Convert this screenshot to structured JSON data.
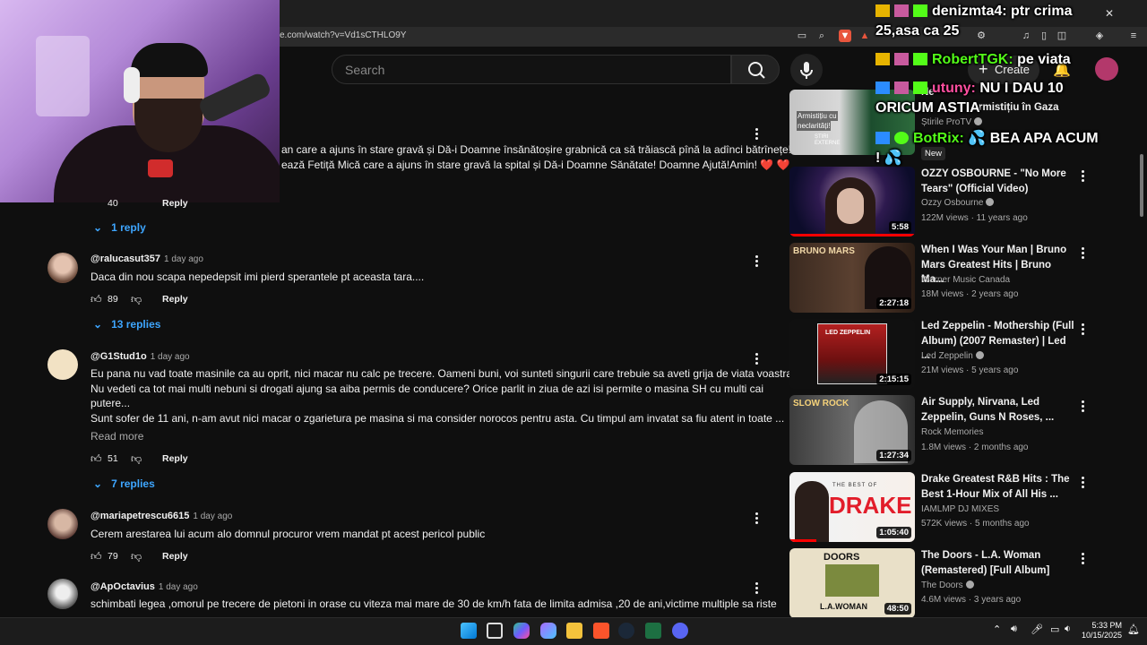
{
  "browser": {
    "url": "e.com/watch?v=Vd1sCTHLO9Y"
  },
  "header": {
    "search_placeholder": "Search",
    "create_label": "Create"
  },
  "comments": {
    "pinned_text_line1": "an care a ajuns în stare gravă și Dă-i Doamne însănătoșire grabnică ca să trăiască pînă la adînci bătrînețe!",
    "pinned_text_line2": "ează Fetiță Mică care a ajuns în stare gravă la spital și Dă-i Doamne Sănătate! Doamne Ajută!Amin! ❤️ ❤️",
    "pinned_likes": "40",
    "pinned_reply": "Reply",
    "pinned_replies": "1 reply",
    "items": [
      {
        "handle": "@ralucasut357",
        "time": "1 day ago",
        "text": "Daca  din nou scapa nepedepsit imi pierd sperantele pt aceasta tara....",
        "likes": "89",
        "reply": "Reply",
        "replies": "13 replies"
      },
      {
        "handle": "@G1Stud1o",
        "time": "1 day ago",
        "text1": "Eu pana nu vad toate masinile ca au oprit, nici macar nu calc pe trecere. Oameni buni, voi sunteti singurii care trebuie sa aveti grija de viata voastra.",
        "text2": "Nu vedeti ca tot mai multi nebuni si drogati ajung sa aiba permis de conducere? Orice parlit in ziua de azi isi permite o masina SH cu multi cai",
        "text3": "putere...",
        "text4": "Sunt sofer de 11 ani, n-am avut nici macar o zgarietura pe masina si ma consider norocos pentru asta. Cu timpul am invatat sa fiu atent in toate ...",
        "read_more": "Read more",
        "likes": "51",
        "reply": "Reply",
        "replies": "7 replies"
      },
      {
        "handle": "@mariapetrescu6615",
        "time": "1 day ago",
        "text": "Cerem arestarea lui acum alo domnul procuror vrem mandat pt acest pericol public",
        "likes": "79",
        "reply": "Reply"
      },
      {
        "handle": "@ApOctavius",
        "time": "1 day ago",
        "text": "schimbati legea ,omorul pe trecere de pietoni in orase cu viteza mai mare de 30 de km/h fata de limita admisa ,20 de ani,victime multiple sa riste"
      }
    ]
  },
  "sidebar": {
    "videos": [
      {
        "title_partial": "Ne",
        "title2_partial": "rmistițiu în Gaza",
        "channel": "Știrile ProTV",
        "badge": "New",
        "thumb_text1": "Armistițiu cu",
        "thumb_text2": "neclarități!",
        "thumb_text3": "ȘTIRI",
        "thumb_text4": "EXTERNE"
      },
      {
        "title": "OZZY OSBOURNE - \"No More Tears\" (Official Video)",
        "channel": "Ozzy Osbourne",
        "meta": "122M views · 11 years ago",
        "duration": "5:58"
      },
      {
        "title": "When I Was Your Man | Bruno Mars Greatest Hits | Bruno Ma...",
        "channel": "Warner Music Canada",
        "meta": "18M views · 2 years ago",
        "duration": "2:27:18",
        "thumb_text": "BRUNO MARS"
      },
      {
        "title": "Led Zeppelin - Mothership (Full Album) (2007 Remaster) | Led ...",
        "channel": "Led Zeppelin",
        "meta": "21M views · 5 years ago",
        "duration": "2:15:15",
        "thumb_text": "LED ZEPPELIN"
      },
      {
        "title": "Air Supply, Nirvana, Led Zeppelin, Guns N Roses, ...",
        "channel": "Rock Memories",
        "meta": "1.8M views · 2 months ago",
        "duration": "1:27:34",
        "thumb_text": "SLOW ROCK"
      },
      {
        "title": "Drake Greatest R&B Hits : The Best 1-Hour Mix of All His ...",
        "channel": "IAMLMP DJ MIXES",
        "meta": "572K views · 5 months ago",
        "duration": "1:05:40",
        "thumb_text": "DRAKE",
        "thumb_text2": "THE BEST OF"
      },
      {
        "title": "The Doors - L.A. Woman (Remastered) [Full Album]",
        "channel": "The Doors",
        "meta": "4.6M views · 3 years ago",
        "duration": "48:50",
        "thumb_text": "DOORS",
        "thumb_text2": "L.A.WOMAN"
      }
    ]
  },
  "overlay_chat": {
    "line1_user": "denizmta4:",
    "line1_msg": "ptr crima",
    "line2": "25,asa ca 25",
    "line3_user": "RobertTGK:",
    "line3_msg": "pe viata",
    "line4_user": "utuny:",
    "line4_msg": "NU I DAU 10",
    "line5": "ORICUM ASTIA",
    "line6_user": "BotRix:",
    "line6_msg": "BEA APA ACUM",
    "line7": "!"
  },
  "taskbar": {
    "time": "5:33 PM",
    "date": "10/15/2025"
  },
  "colors": {
    "background": "#0f0f0f",
    "link_blue": "#3ea6ff",
    "progress_red": "#ff0000"
  }
}
